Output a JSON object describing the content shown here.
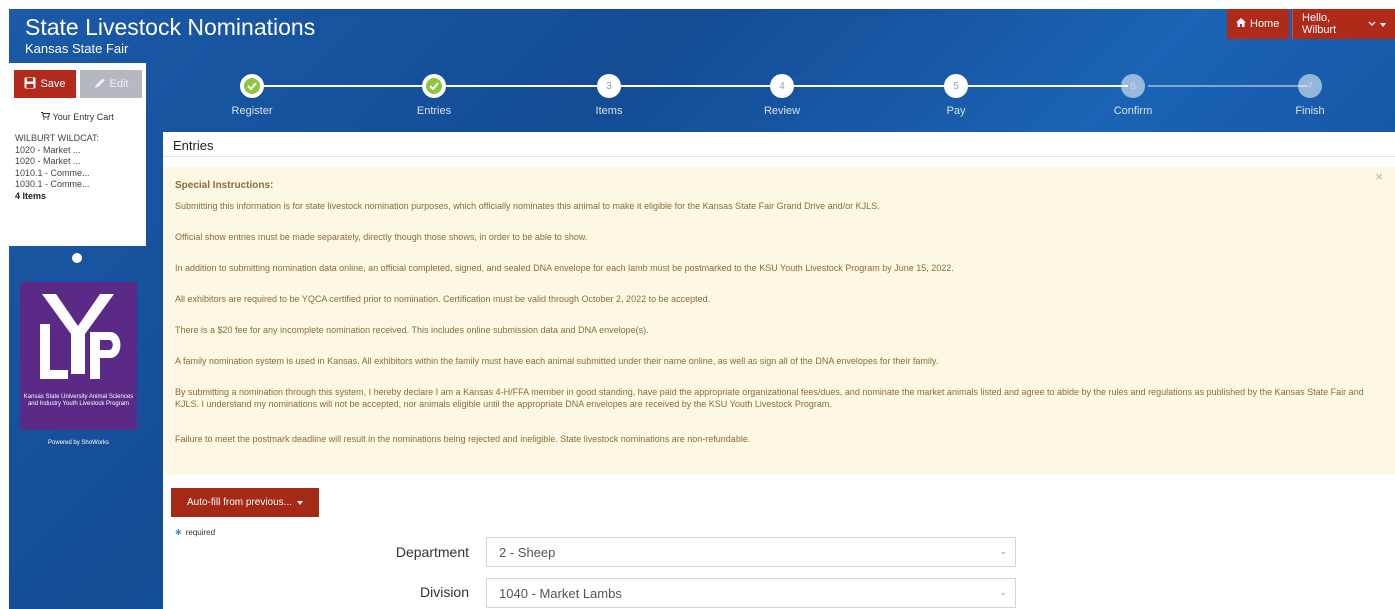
{
  "header": {
    "title": "State Livestock Nominations",
    "subtitle": "Kansas State Fair",
    "home_label": "Home",
    "user_label": "Hello, Wilburt"
  },
  "sidebar": {
    "save_label": "Save",
    "edit_label": "Edit",
    "cart_title": "Your Entry Cart",
    "cart_owner": "WILBURT WILDCAT:",
    "cart_items": [
      "1020 - Market ...",
      "1020 - Market ...",
      "1010.1 - Comme...",
      "1030.1 - Comme..."
    ],
    "cart_count": "4 Items",
    "logo_letters": "LYP",
    "logo_caption": "Kansas State University Animal Sciences and Industry Youth Livestock Program",
    "powered_by": "Powered by ShoWorks"
  },
  "stepper": {
    "steps": [
      {
        "number": "1",
        "label": "Register",
        "state": "done"
      },
      {
        "number": "2",
        "label": "Entries",
        "state": "done"
      },
      {
        "number": "3",
        "label": "Items",
        "state": "todo"
      },
      {
        "number": "4",
        "label": "Review",
        "state": "todo"
      },
      {
        "number": "5",
        "label": "Pay",
        "state": "todo"
      },
      {
        "number": "6",
        "label": "Confirm",
        "state": "future"
      },
      {
        "number": "7",
        "label": "Finish",
        "state": "future"
      }
    ]
  },
  "main": {
    "section_title": "Entries",
    "instructions": {
      "heading": "Special Instructions:",
      "paragraphs": [
        "Submitting this information is for state livestock nomination purposes, which  officially nominates this animal to make it eligible for the Kansas State Fair Grand Drive and/or KJLS.",
        " Official show entries must be made separately, directly though those shows, in order to be able to show.",
        "In addition to submitting nomination data online, an official completed, signed, and sealed DNA envelope for each lamb  must be postmarked to the KSU Youth Livestock Program by June 15, 2022.",
        "All exhibitors are required to be YQCA certified prior to nomination. Certification must be valid through October 2, 2022 to be accepted.",
        "There is a $20 fee for any incomplete nomination received. This includes online submission data and DNA envelope(s).",
        "A family nomination system is used in Kansas. All exhibitors within the family must have each animal submitted under their name online, as well as sign all of the DNA envelopes for their family.",
        "By submitting a nomination through this system, I hereby declare I am a Kansas 4-H/FFA member in good standing, have paid the appropriate  organizational fees/dues, and  nominate the market animals listed and agree to abide by the rules and regulations as published by the Kansas State Fair and KJLS. I understand my nominations will not be accepted, nor animals eligible until the appropriate DNA envelopes are received by the KSU Youth Livestock Program.",
        "Failure to meet the postmark deadline will result in the nominations being  rejected and ineligible. State livestock nominations are non-refundable."
      ]
    },
    "autofill_label": "Auto-fill from previous...",
    "required_note": "required",
    "form": {
      "department_label": "Department",
      "department_value": "2 - Sheep",
      "division_label": "Division",
      "division_value": "1040 - Market Lambs"
    }
  },
  "colors": {
    "header_blue": "#144c95",
    "action_red": "#b02a1a",
    "alert_bg": "#fcf8e3",
    "alert_text": "#8a6d3b",
    "step_done_green": "#8dc63f",
    "logo_purple": "#5b2a86"
  }
}
